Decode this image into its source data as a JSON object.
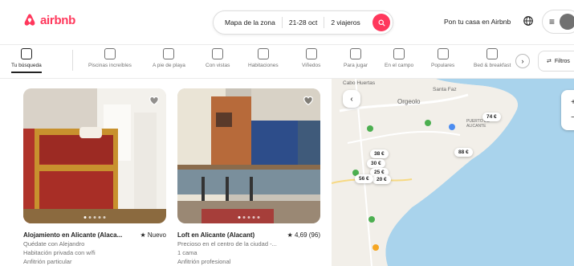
{
  "brand": {
    "name": "airbnb",
    "color": "#ff385c"
  },
  "search": {
    "location": "Mapa de la zona",
    "dates": "21-28 oct",
    "guests": "2 viajeros"
  },
  "header": {
    "host_label": "Pon tu casa en Airbnb"
  },
  "categories": [
    {
      "label": "Tu búsqueda",
      "active": true
    },
    {
      "label": "Piscinas increíbles"
    },
    {
      "label": "A pie de playa"
    },
    {
      "label": "Con vistas"
    },
    {
      "label": "Habitaciones"
    },
    {
      "label": "Viñedos"
    },
    {
      "label": "Para jugar"
    },
    {
      "label": "En el campo"
    },
    {
      "label": "Populares"
    },
    {
      "label": "Bed & breakfast"
    }
  ],
  "filters_label": "Filtros",
  "listings": [
    {
      "title": "Alojamiento en Alicante (Alaca...",
      "rating": "★ Nuevo",
      "lines": [
        "Quédate con Alejandro",
        "Habitación privada con w/fi",
        "Anfitrión particular"
      ]
    },
    {
      "title": "Loft en Alicante (Alacant)",
      "rating": "★ 4,69 (96)",
      "lines": [
        "Precioso en el centro de la ciudad -...",
        "1 cama",
        "Anfitrión profesional"
      ]
    }
  ],
  "map": {
    "labels": {
      "top": "Cabo Huertas",
      "district": "Orgeolo",
      "area": "Santa Faz",
      "port": "PUERTO DE ALICANTE"
    },
    "prices": [
      "74 €",
      "88 €",
      "38 €",
      "30 €",
      "25 €",
      "20 €",
      "56 €"
    ],
    "back_icon": "chevron-left-icon",
    "zoom_in": "+",
    "zoom_out": "−"
  }
}
